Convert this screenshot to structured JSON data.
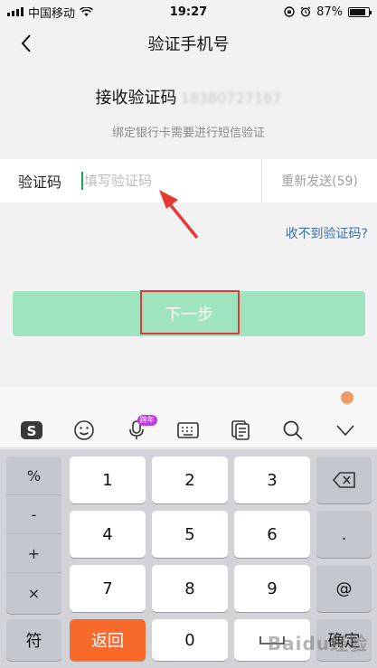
{
  "status_bar": {
    "carrier": "中国移动",
    "time": "19:27",
    "battery": "87%",
    "battery_level": 0.87
  },
  "nav": {
    "title": "验证手机号"
  },
  "receive": {
    "label": "接收验证码",
    "phone": "18380727167"
  },
  "hint": "绑定银行卡需要进行短信验证",
  "code_row": {
    "label": "验证码",
    "placeholder": "填写验证码",
    "resend": "重新发送(59)"
  },
  "not_received": "收不到验证码?",
  "next_button": "下一步",
  "keyboard": {
    "toolbar_badge": "跨年",
    "symbols": [
      "%",
      "-",
      "+",
      "×"
    ],
    "digits": [
      "1",
      "2",
      "3",
      "4",
      "5",
      "6",
      "7",
      "8",
      "9",
      "0"
    ],
    "dot": ".",
    "at": "@",
    "symbol_key": "符",
    "return_key": "返回",
    "confirm_key": "确定"
  },
  "watermark": "Baidu经验",
  "colors": {
    "accent_green": "#9ee4be",
    "link_blue": "#3b6fb0",
    "annotation_red": "#e53935",
    "return_orange": "#f86a2c"
  }
}
